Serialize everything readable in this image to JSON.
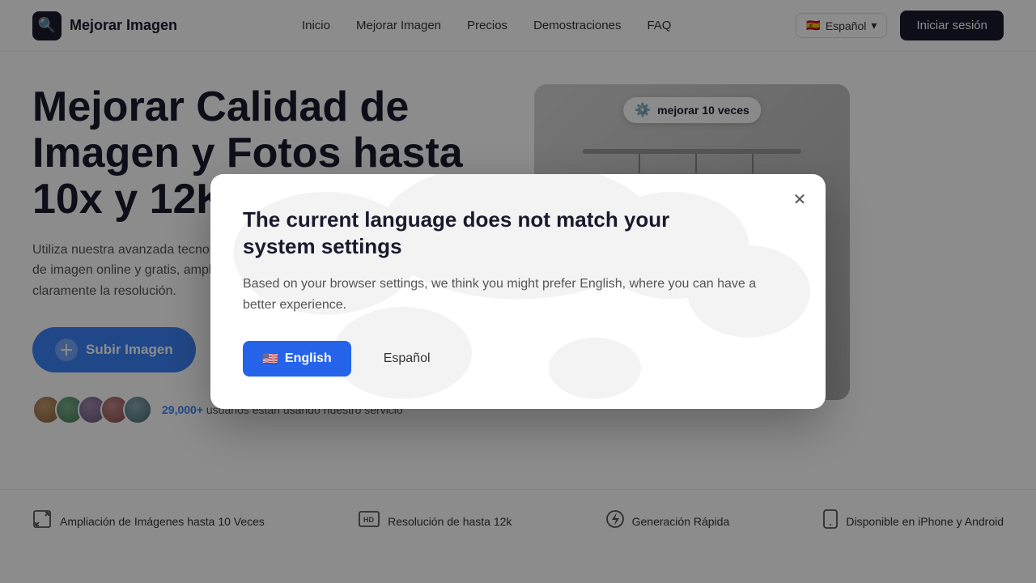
{
  "nav": {
    "logo_icon": "🔍",
    "logo_text": "Mejorar Imagen",
    "links": [
      {
        "label": "Inicio",
        "href": "#"
      },
      {
        "label": "Mejorar Imagen",
        "href": "#"
      },
      {
        "label": "Precios",
        "href": "#"
      },
      {
        "label": "Demostraciones",
        "href": "#"
      },
      {
        "label": "FAQ",
        "href": "#"
      }
    ],
    "language_flag": "🇪🇸",
    "language_label": "Español",
    "signin_label": "Iniciar sesión"
  },
  "hero": {
    "title": "Mejorar Calidad de Imagen y Fotos hasta 10x y 12K",
    "description": "Utiliza nuestra avanzada tecnología de IA para mejorar la calidad de imagen online y gratis, ampliando hasta 12K, mejorando claramente la resolución.",
    "upload_button": "Subir Imagen",
    "badge_text": "mejorar 10 veces",
    "social_count": "29,000+",
    "social_text": "usuarios están usando nuestro servicio"
  },
  "features": [
    {
      "icon": "⊡",
      "text": "Ampliación de Imágenes hasta 10 Veces"
    },
    {
      "icon": "HD",
      "text": "Resolución de hasta 12k"
    },
    {
      "icon": "⚡",
      "text": "Generación Rápida"
    },
    {
      "icon": "📱",
      "text": "Disponible en iPhone y Android"
    }
  ],
  "modal": {
    "title": "The current language does not match your system settings",
    "description": "Based on your browser settings, we think you might prefer English, where you can have a better experience.",
    "btn_english_flag": "🇺🇸",
    "btn_english_label": "English",
    "btn_spanish_label": "Español",
    "close_icon": "✕"
  }
}
